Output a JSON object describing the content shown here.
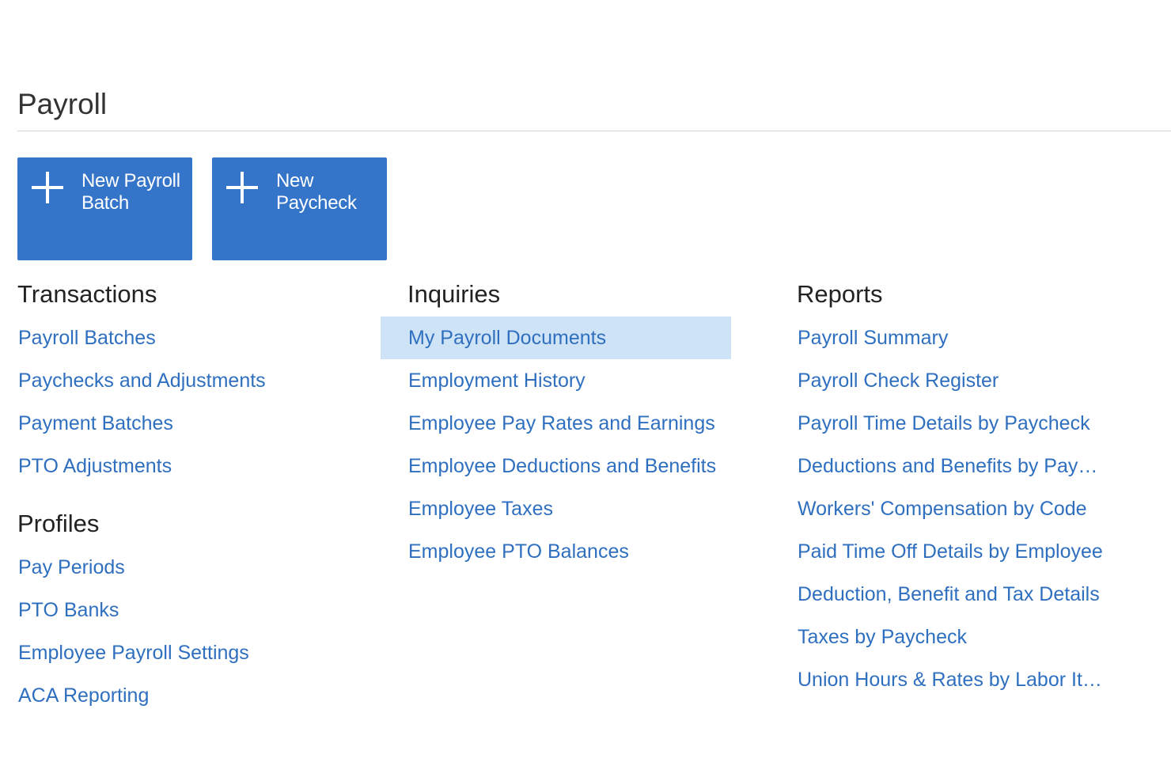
{
  "page": {
    "title": "Payroll"
  },
  "tiles": [
    {
      "label": "New Payroll Batch",
      "icon": "plus-icon"
    },
    {
      "label": "New Paycheck",
      "icon": "plus-icon"
    }
  ],
  "transactions": {
    "heading": "Transactions",
    "items": [
      "Payroll Batches",
      "Paychecks and Adjustments",
      "Payment Batches",
      "PTO Adjustments"
    ]
  },
  "profiles": {
    "heading": "Profiles",
    "items": [
      "Pay Periods",
      "PTO Banks",
      "Employee Payroll Settings",
      "ACA Reporting"
    ]
  },
  "inquiries": {
    "heading": "Inquiries",
    "selected_index": 0,
    "items": [
      "My Payroll Documents",
      "Employment History",
      "Employee Pay Rates and Earnings",
      "Employee Deductions and Benefits",
      "Employee Taxes",
      "Employee PTO Balances"
    ]
  },
  "reports": {
    "heading": "Reports",
    "items": [
      "Payroll Summary",
      "Payroll Check Register",
      "Payroll Time Details by Paycheck",
      "Deductions and Benefits by Pay…",
      "Workers' Compensation by Code",
      "Paid Time Off Details by Employee",
      "Deduction, Benefit and Tax Details",
      "Taxes by Paycheck",
      "Union Hours & Rates by Labor It…"
    ]
  },
  "colors": {
    "tile_background": "#3475c9",
    "link": "#2f6fbf",
    "selected_background": "#cfe3f6"
  }
}
